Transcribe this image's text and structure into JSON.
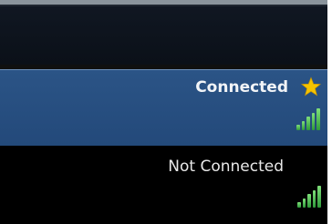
{
  "networks": [
    {
      "status_label": "Connected",
      "selected": true,
      "favorite_icon": "star-icon",
      "signal_icon": "signal-strength-icon",
      "signal_bars_lit": 5,
      "signal_bars_total": 5
    },
    {
      "status_label": "Not Connected",
      "selected": false,
      "signal_icon": "signal-strength-icon",
      "signal_bars_lit": 5,
      "signal_bars_total": 5
    }
  ],
  "colors": {
    "selected_row": "#2b5486",
    "background": "#000000",
    "star": "#f5c400",
    "signal": "#4ec24a"
  }
}
